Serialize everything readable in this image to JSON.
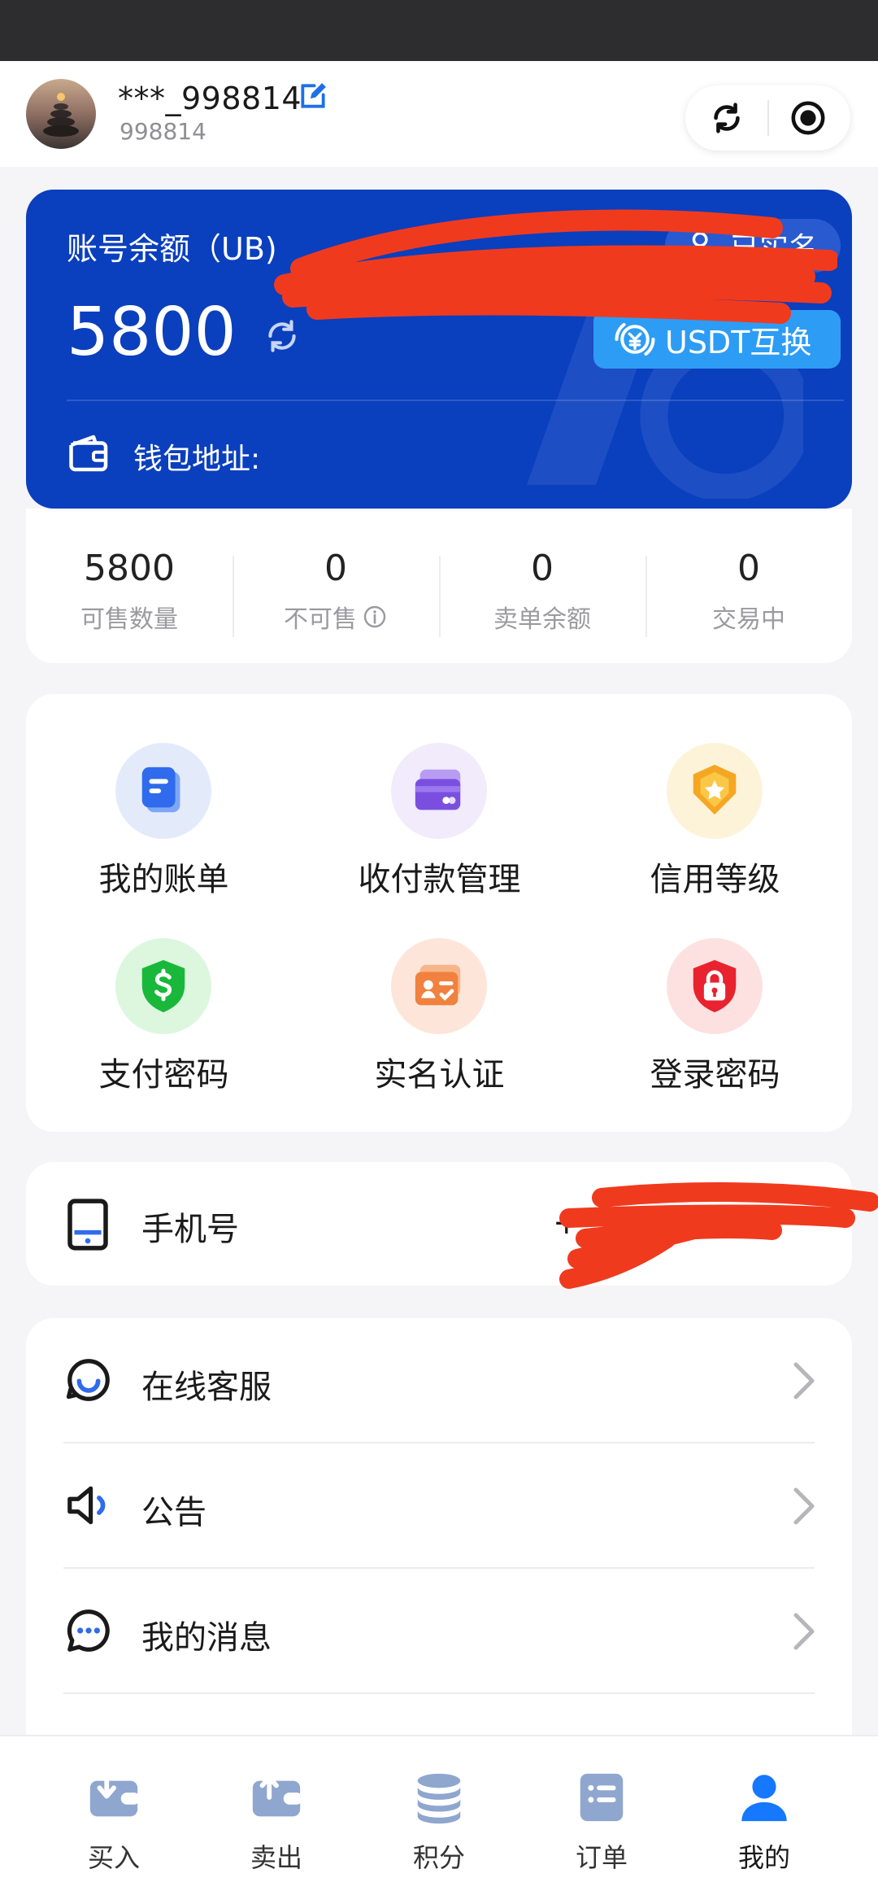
{
  "header": {
    "username": "***_998814",
    "user_id": "998814"
  },
  "balance": {
    "label": "账号余额（UB)",
    "amount": "5800",
    "verified_label": "已实名",
    "usdt_label": "USDT互换",
    "wallet_label": "钱包地址:"
  },
  "stats": [
    {
      "value": "5800",
      "label": "可售数量"
    },
    {
      "value": "0",
      "label": "不可售"
    },
    {
      "value": "0",
      "label": "卖单余额"
    },
    {
      "value": "0",
      "label": "交易中"
    }
  ],
  "grid": [
    {
      "label": "我的账单",
      "icon": "bill-icon"
    },
    {
      "label": "收付款管理",
      "icon": "card-icon"
    },
    {
      "label": "信用等级",
      "icon": "badge-star-icon"
    },
    {
      "label": "支付密码",
      "icon": "shield-dollar-icon"
    },
    {
      "label": "实名认证",
      "icon": "id-card-icon"
    },
    {
      "label": "登录密码",
      "icon": "lock-icon"
    }
  ],
  "phone": {
    "label": "手机号",
    "value": "+"
  },
  "menu": [
    {
      "label": "在线客服",
      "icon": "customer-service-icon"
    },
    {
      "label": "公告",
      "icon": "speaker-icon"
    },
    {
      "label": "我的消息",
      "icon": "message-icon"
    }
  ],
  "tabs": [
    {
      "label": "买入",
      "icon": "buy-icon"
    },
    {
      "label": "卖出",
      "icon": "sell-icon"
    },
    {
      "label": "积分",
      "icon": "points-icon"
    },
    {
      "label": "订单",
      "icon": "orders-icon"
    },
    {
      "label": "我的",
      "icon": "profile-icon"
    }
  ],
  "colors": {
    "card_blue": "#0a3fbe",
    "usdt_button": "#2d9cf5",
    "tab_active": "#1677ff",
    "tab_inactive": "#8a9bb8",
    "redaction": "#f03a1e"
  }
}
